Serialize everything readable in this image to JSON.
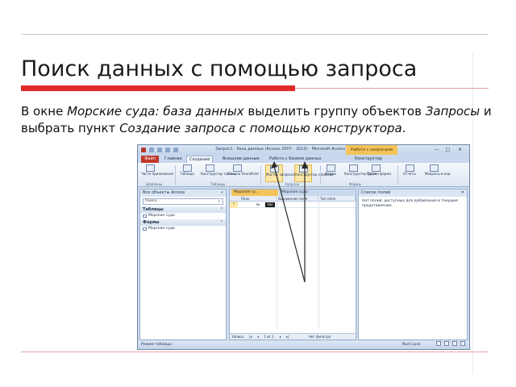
{
  "slide": {
    "title": "Поиск данных с помощью запроса",
    "text_1": "В окне ",
    "text_2": "Морские суда: база данных",
    "text_3": " выделить группу объектов ",
    "text_4": "Запросы",
    "text_5": " и выбрать пункт ",
    "text_6": "Создание запроса с помощью конструктора",
    "text_7": "."
  },
  "window": {
    "title": "Запрос1 : база данных (Access 2007 - 2010) - Microsoft Access",
    "context_tab": "Работа с запросами",
    "min": "—",
    "max": "□",
    "close": "✕"
  },
  "ribbon_tabs": [
    "Файл",
    "Главная",
    "Создание",
    "Внешние данные",
    "Работа с базами данных",
    "Конструктор"
  ],
  "ribbon": {
    "buttons": [
      "Части приложения",
      "Таблица",
      "Конструктор таблиц",
      "Списки SharePoint",
      "Мастер запросов",
      "Конструктор запросов",
      "Форма",
      "Конструктор форм",
      "Пустая форма",
      "Отчеты",
      "Макросы и код"
    ],
    "groups": [
      "Шаблоны",
      "Таблицы",
      "Запросы",
      "Формы"
    ]
  },
  "nav": {
    "header": "Все объекты Access",
    "search_placeholder": "Поиск...",
    "groups": [
      {
        "label": "Таблицы",
        "items": [
          "Морские суда"
        ]
      },
      {
        "label": "Формы",
        "items": [
          "Морские суда"
        ]
      }
    ]
  },
  "doc": {
    "tab_1": "Морские су...",
    "tab_2": "Морские суда",
    "col_1": "Поле",
    "col_2": "Выражение поля",
    "col_3": "Тип поля",
    "row_marker": "*",
    "row_num": "№",
    "new_label": "(№)",
    "footer_record": "Запись:",
    "footer_pos": "1 из 1",
    "footer_filter": "Нет фильтра"
  },
  "fields": {
    "header": "Список полей",
    "message": "Нет полей, доступных для добавления в текущее представление."
  },
  "status": {
    "left": "Режим таблицы",
    "right": "Num Lock"
  }
}
